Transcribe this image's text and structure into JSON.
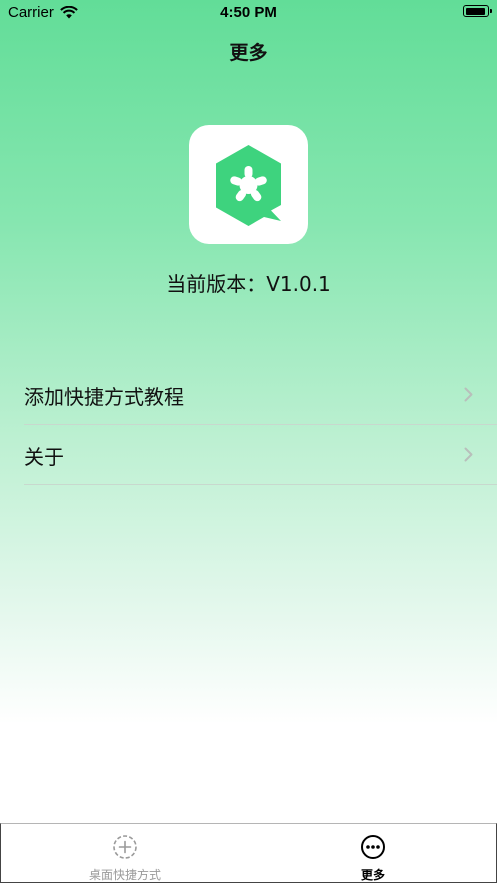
{
  "status_bar": {
    "carrier": "Carrier",
    "time": "4:50 PM"
  },
  "nav": {
    "title": "更多"
  },
  "app": {
    "version_label": "当前版本：",
    "version_value": "V1.0.1"
  },
  "menu": {
    "items": [
      {
        "label": "添加快捷方式教程",
        "icon": "chevron-right-icon"
      },
      {
        "label": "关于",
        "icon": "chevron-right-icon"
      }
    ]
  },
  "tab_bar": {
    "tabs": [
      {
        "label": "桌面快捷方式",
        "icon": "add-circle-dashed-icon",
        "selected": false
      },
      {
        "label": "更多",
        "icon": "more-circle-icon",
        "selected": true
      }
    ]
  },
  "colors": {
    "brand_green": "#3ed37e",
    "gradient_top": "#62dd98",
    "selected_tab": "#000000",
    "unselected_tab": "#9a9a9a"
  }
}
